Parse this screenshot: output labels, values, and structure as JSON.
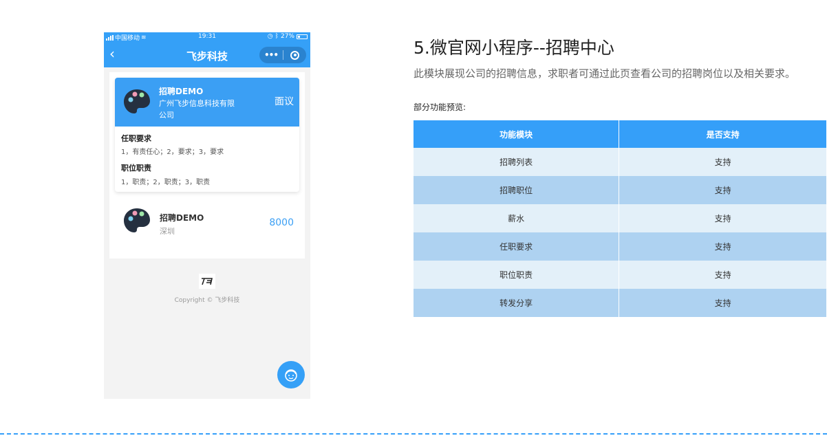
{
  "colors": {
    "primary": "#35a0f7",
    "row_light": "#e3f0f9",
    "row_dark": "#aed2f1"
  },
  "phone": {
    "status": {
      "carrier": "中国移动",
      "time": "19:31",
      "battery": "27%",
      "battery_level": 0.27
    },
    "nav": {
      "back_icon": "chevron-left-icon",
      "title": "飞步科技",
      "more_icon": "more-dots-icon",
      "close_icon": "target-icon"
    },
    "jobs": [
      {
        "title": "招聘DEMO",
        "company": "广州飞步信息科技有限公司",
        "salary": "面议",
        "requirements_title": "任职要求",
        "requirements": "1，有责任心；2，要求；3，要求",
        "duties_title": "职位职责",
        "duties": "1，职责；2，职责；3，职责"
      },
      {
        "title": "招聘DEMO",
        "location": "深圳",
        "salary": "8000"
      }
    ],
    "footer": {
      "logo_icon": "company-logo-icon",
      "copyright": "Copyright © 飞步科技"
    },
    "service_icon": "customer-service-icon"
  },
  "section": {
    "title": "5.微官网小程序--招聘中心",
    "description": "此模块展现公司的招聘信息，求职者可通过此页查看公司的招聘岗位以及相关要求。",
    "preview_label": "部分功能预览:",
    "table": {
      "headers": [
        "功能模块",
        "是否支持"
      ],
      "rows": [
        [
          "招聘列表",
          "支持"
        ],
        [
          "招聘职位",
          "支持"
        ],
        [
          "薪水",
          "支持"
        ],
        [
          "任职要求",
          "支持"
        ],
        [
          "职位职责",
          "支持"
        ],
        [
          "转发分享",
          "支持"
        ]
      ]
    }
  }
}
